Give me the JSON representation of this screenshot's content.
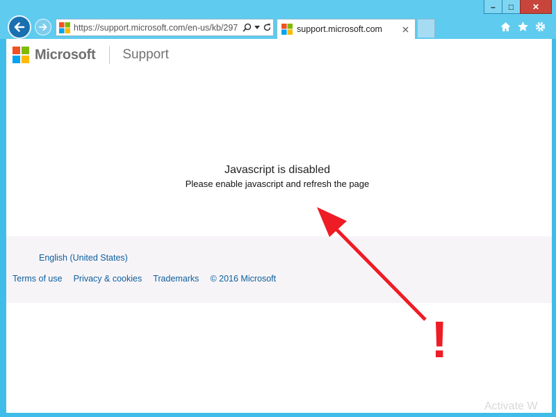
{
  "browser": {
    "address_url": "https://support.microsoft.com/en-us/kb/297",
    "tab_title": "support.microsoft.com",
    "window_controls": {
      "minimize_glyph": "–",
      "maximize_glyph": "□",
      "close_glyph": "✕"
    },
    "toolbar_icons": [
      "home-icon",
      "favorites-star-icon",
      "settings-gear-icon"
    ]
  },
  "page": {
    "brand": "Microsoft",
    "section": "Support",
    "message_title": "Javascript is disabled",
    "message_body": "Please enable javascript and refresh the page",
    "footer": {
      "language": "English (United States)",
      "links": [
        "Terms of use",
        "Privacy & cookies",
        "Trademarks",
        "© 2016 Microsoft"
      ]
    }
  },
  "watermark": "Activate W",
  "colors": {
    "accent": "#1a6fb0",
    "link": "#0b5f9c",
    "annotation_red": "#ee1c24",
    "ms_red": "#f25022",
    "ms_green": "#7fba00",
    "ms_blue": "#00a4ef",
    "ms_yellow": "#ffb900"
  }
}
